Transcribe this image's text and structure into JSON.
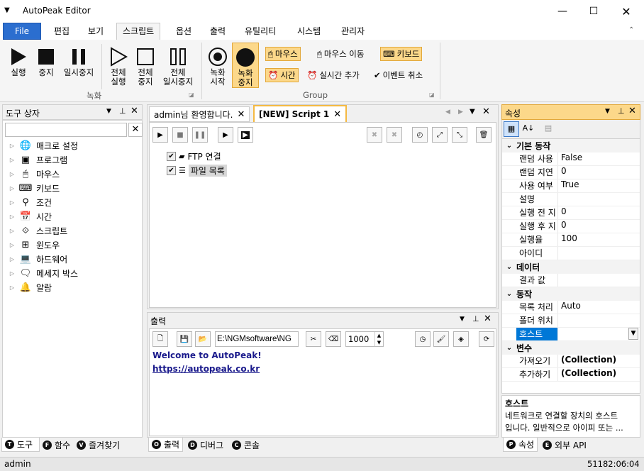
{
  "window": {
    "title": "AutoPeak Editor"
  },
  "menu": {
    "file": "File",
    "items": [
      "편집",
      "보기",
      "스크립트",
      "옵션",
      "출력",
      "유틸리티",
      "시스템",
      "관리자"
    ]
  },
  "ribbon": {
    "run": "실행",
    "stop": "중지",
    "pause": "일시중지",
    "run_all": [
      "전체",
      "실행"
    ],
    "stop_all": [
      "전체",
      "중지"
    ],
    "pause_all": [
      "전체",
      "일시중지"
    ],
    "group1": "녹화",
    "rec_start": [
      "녹화",
      "시작"
    ],
    "rec_stop": [
      "녹화",
      "중지"
    ],
    "mouse": "마우스",
    "mouse_move": "마우스 이동",
    "keyboard": "키보드",
    "time": "시간",
    "realtime_add": "실시간 추가",
    "event_cancel": "이벤트 취소",
    "group2": "Group"
  },
  "toolbox": {
    "title": "도구 상자",
    "items": [
      {
        "label": "매크로 설정",
        "icon": "globe-icon"
      },
      {
        "label": "프로그램",
        "icon": "program-icon"
      },
      {
        "label": "마우스",
        "icon": "mouse-icon"
      },
      {
        "label": "키보드",
        "icon": "keyboard-icon"
      },
      {
        "label": "조건",
        "icon": "condition-icon"
      },
      {
        "label": "시간",
        "icon": "calendar-icon"
      },
      {
        "label": "스크립트",
        "icon": "script-icon"
      },
      {
        "label": "윈도우",
        "icon": "windows-icon"
      },
      {
        "label": "하드웨어",
        "icon": "laptop-icon"
      },
      {
        "label": "메세지 박스",
        "icon": "message-icon"
      },
      {
        "label": "알람",
        "icon": "bell-icon"
      }
    ]
  },
  "doc_tabs": {
    "welcome": "admin님 환영합니다.",
    "script": "[NEW] Script 1"
  },
  "script_tree": [
    {
      "label": "FTP 연결"
    },
    {
      "label": "파일 목록"
    }
  ],
  "output": {
    "title": "출력",
    "path": "E:\\NGMsoftware\\NG",
    "count": "1000",
    "welcome": "Welcome to AutoPeak!",
    "link": "https://autopeak.co.kr"
  },
  "left_tabs": [
    "도구",
    "함수",
    "즐겨찾기"
  ],
  "left_tab_letters": [
    "T",
    "F",
    "V"
  ],
  "bottom_tabs": [
    "출력",
    "디버그",
    "콘솔"
  ],
  "bottom_tab_letters": [
    "O",
    "D",
    "C"
  ],
  "properties": {
    "title": "속성",
    "categories": [
      {
        "name": "기본 동작",
        "rows": [
          {
            "n": "랜덤 사용",
            "v": "False"
          },
          {
            "n": "랜덤 지연",
            "v": "0"
          },
          {
            "n": "사용 여부",
            "v": "True"
          },
          {
            "n": "설명",
            "v": ""
          },
          {
            "n": "실행 전 지",
            "v": "0"
          },
          {
            "n": "실행 후 지",
            "v": "0"
          },
          {
            "n": "실행율",
            "v": "100"
          },
          {
            "n": "아이디",
            "v": ""
          }
        ]
      },
      {
        "name": "데이터",
        "rows": [
          {
            "n": "결과 값",
            "v": ""
          }
        ]
      },
      {
        "name": "동작",
        "rows": [
          {
            "n": "목록 처리",
            "v": "Auto"
          },
          {
            "n": "폴더 위치",
            "v": ""
          },
          {
            "n": "호스트",
            "v": "",
            "selected": true
          }
        ]
      },
      {
        "name": "변수",
        "rows": [
          {
            "n": "가져오기",
            "v": "(Collection)",
            "bold": true
          },
          {
            "n": "추가하기",
            "v": "(Collection)",
            "bold": true
          }
        ]
      }
    ],
    "desc_title": "호스트",
    "desc_text": [
      "네트워크로 연결할 장치의 호스트",
      "입니다. 일반적으로 아이피 또는 ..."
    ]
  },
  "right_tabs": [
    "속성",
    "외부 API"
  ],
  "right_tab_letters": [
    "P",
    "E"
  ],
  "status": {
    "user": "admin",
    "time": "51182:06:04"
  }
}
